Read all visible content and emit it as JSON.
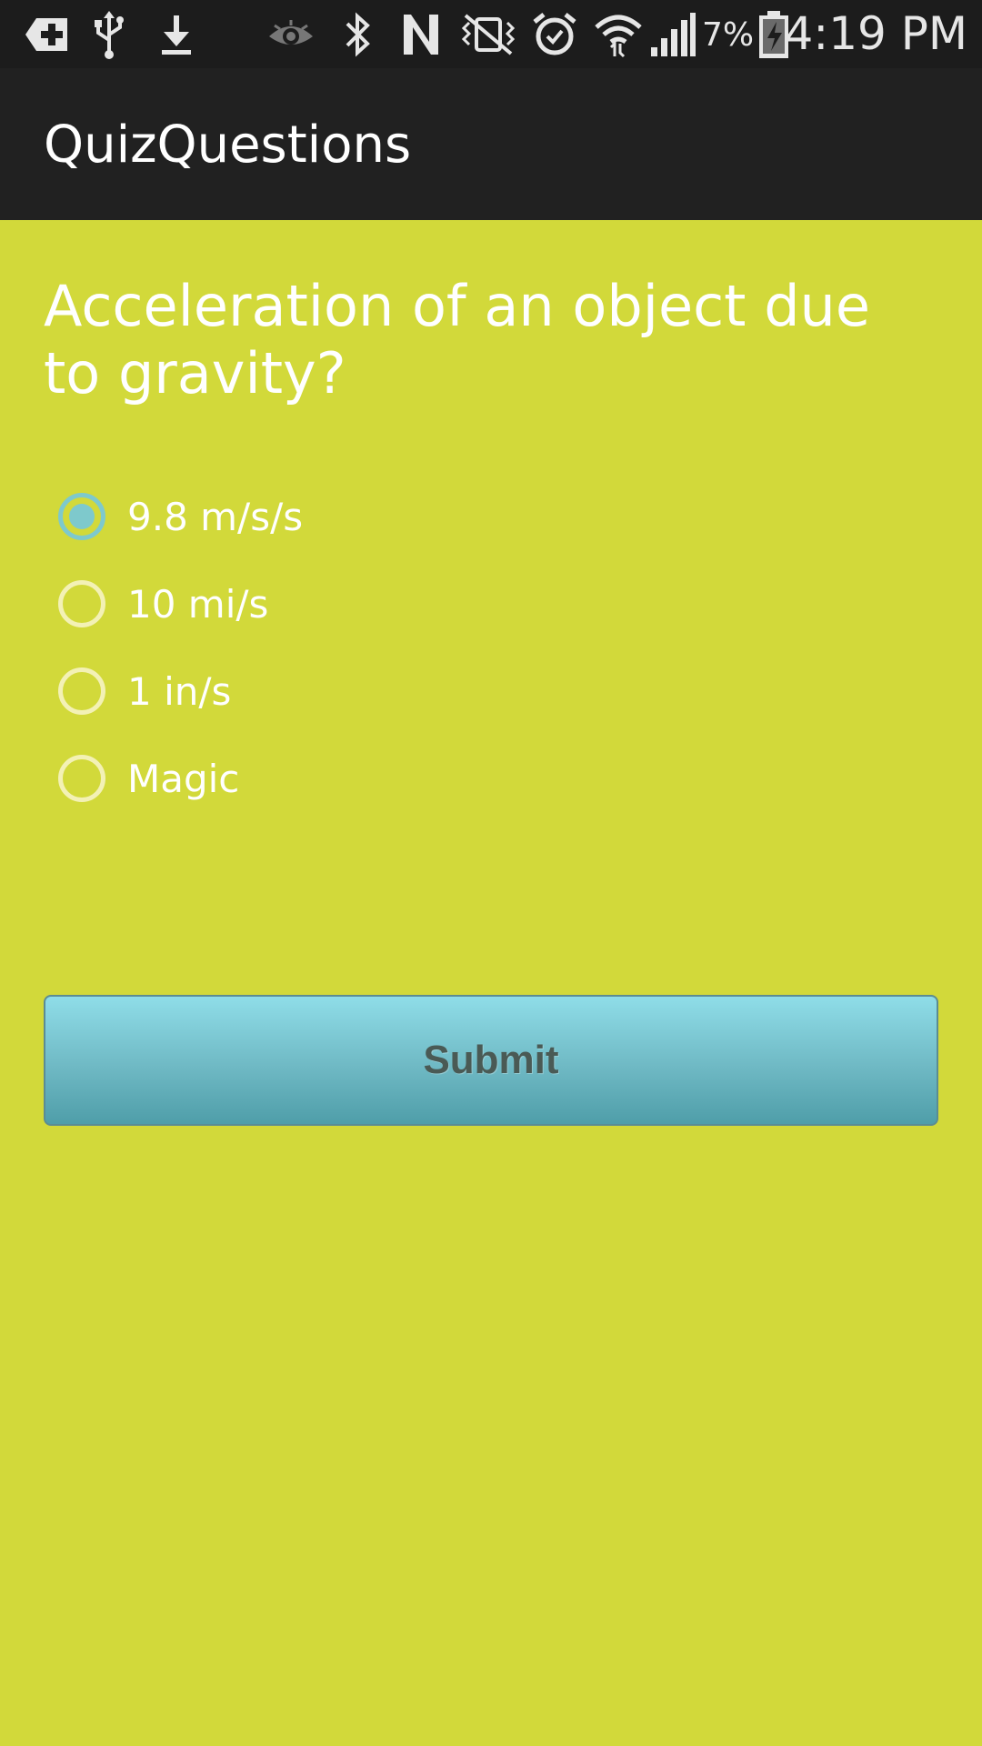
{
  "status_bar": {
    "icons": [
      "add-notification-icon",
      "usb-icon",
      "download-icon",
      "eye-icon",
      "bluetooth-icon",
      "nfc-icon",
      "vibrate-icon",
      "alarm-icon",
      "wifi-icon",
      "signal-icon",
      "battery-charging-icon"
    ],
    "battery_percent": "7%",
    "time": "4:19 PM"
  },
  "action_bar": {
    "title": "QuizQuestions"
  },
  "quiz": {
    "question": "Acceleration of an object due to gravity?",
    "options": [
      {
        "label": "9.8 m/s/s",
        "selected": true
      },
      {
        "label": "10 mi/s",
        "selected": false
      },
      {
        "label": "1 in/s",
        "selected": false
      },
      {
        "label": "Magic",
        "selected": false
      }
    ],
    "submit_label": "Submit"
  },
  "colors": {
    "background": "#d2d93a",
    "action_bar": "#212121",
    "status_bar": "#1c1c1c",
    "radio_checked": "#7ec9cc",
    "radio_unchecked": "#f3f1b5",
    "button_top": "#8fdde8",
    "button_bottom": "#4f9ea9"
  }
}
